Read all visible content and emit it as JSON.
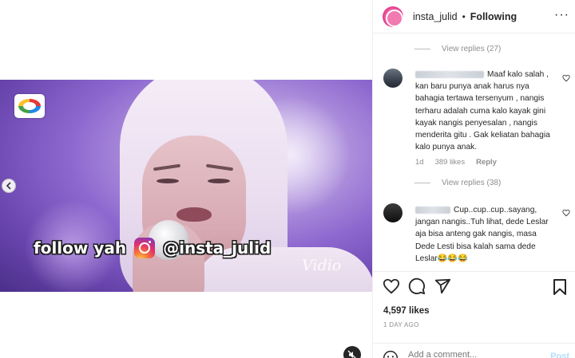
{
  "header": {
    "username": "insta_julid",
    "separator": "•",
    "following_label": "Following",
    "more_label": "···"
  },
  "media": {
    "overlay_follow": "follow yah",
    "overlay_handle": "@insta_julid",
    "watermark": "Vidio"
  },
  "comments": {
    "view_replies_1": "View replies (27)",
    "comment_1_text": "Maaf kalo salah , kan baru punya anak harus nya bahagia tertawa tersenyum , nangis terharu adalah cuma kalo kayak gini kayak nangis penyesalan , nangis menderita gitu . Gak keliatan bahagia kalo punya anak.",
    "comment_1_age": "1d",
    "comment_1_likes": "389 likes",
    "comment_1_reply": "Reply",
    "view_replies_2": "View replies (38)",
    "comment_2_text": "Cup..cup..cup..sayang, jangan nangis..Tuh lihat, dede Leslar aja bisa anteng gak nangis, masa Dede Lesti bisa kalah sama dede Leslar😂😂😂"
  },
  "actions": {
    "likes": "4,597 likes",
    "date": "1 DAY AGO"
  },
  "add_comment": {
    "placeholder": "Add a comment...",
    "post_label": "Post"
  },
  "icons": [
    "heart-icon",
    "comment-icon",
    "share-icon",
    "bookmark-icon",
    "emoji-icon",
    "chevron-left-icon",
    "mute-icon",
    "instagram-logo"
  ],
  "colors": {
    "accent": "#0095f6",
    "post_disabled": "#b2dffc",
    "muted_text": "#8e8e8e"
  }
}
